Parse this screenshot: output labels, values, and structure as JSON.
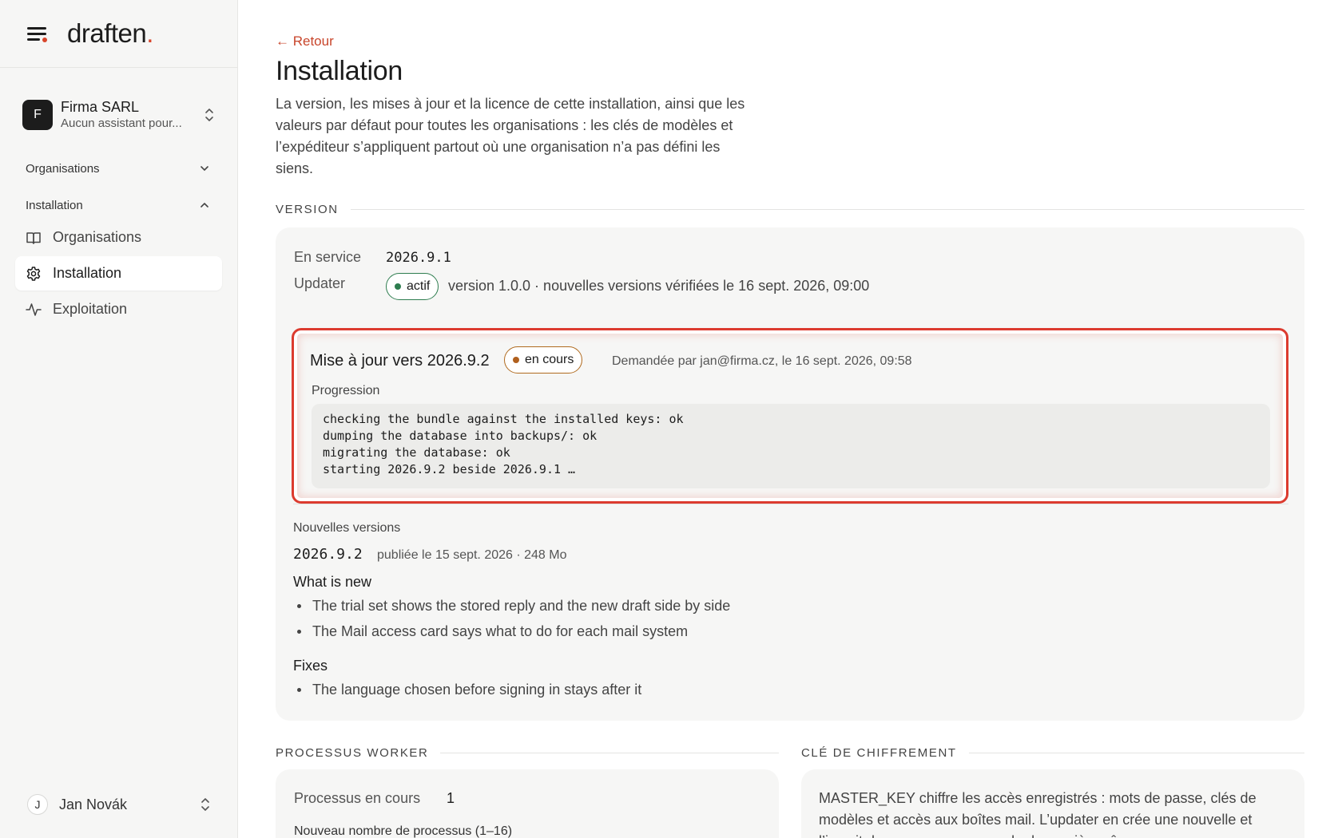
{
  "app": {
    "brand": "draften",
    "brand_dot": "."
  },
  "org": {
    "initial": "F",
    "name": "Firma SARL",
    "subtitle": "Aucun assistant pour..."
  },
  "nav": {
    "group_organisations": "Organisations",
    "group_installation": "Installation",
    "items": [
      {
        "label": "Organisations",
        "icon": "book-icon"
      },
      {
        "label": "Installation",
        "icon": "gear-icon",
        "active": true
      },
      {
        "label": "Exploitation",
        "icon": "activity-icon"
      }
    ]
  },
  "user": {
    "initial": "J",
    "name": "Jan Novák"
  },
  "page": {
    "back": "← Retour",
    "title": "Installation",
    "intro": "La version, les mises à jour et la licence de cette installation, ainsi que les valeurs par défaut pour toutes les organisations : les clés de modèles et l’expéditeur s’appliquent partout où une organisation n’a pas défini les siens."
  },
  "version": {
    "section": "VERSION",
    "in_service_label": "En service",
    "in_service_value": "2026.9.1",
    "updater_label": "Updater",
    "updater_badge": "actif",
    "updater_text": "version 1.0.0 · nouvelles versions vérifiées le 16 sept. 2026, 09:00",
    "update": {
      "title": "Mise à jour vers 2026.9.2",
      "badge": "en cours",
      "requested": "Demandée par jan@firma.cz, le 16 sept. 2026, 09:58",
      "progress_label": "Progression",
      "log": "checking the bundle against the installed keys: ok\ndumping the database into backups/: ok\nmigrating the database: ok\nstarting 2026.9.2 beside 2026.9.1 …"
    },
    "new_versions_label": "Nouvelles versions",
    "release": {
      "version": "2026.9.2",
      "meta": "publiée le 15 sept. 2026 · 248 Mo",
      "whats_new_heading": "What is new",
      "whats_new": [
        "The trial set shows the stored reply and the new draft side by side",
        "The Mail access card says what to do for each mail system"
      ],
      "fixes_heading": "Fixes",
      "fixes": [
        "The language chosen before signing in stays after it"
      ]
    }
  },
  "worker": {
    "section": "PROCESSUS WORKER",
    "running_label": "Processus en cours",
    "running_value": "1",
    "new_count_label": "Nouveau nombre de processus (1–16)"
  },
  "encryption": {
    "section": "CLÉ DE CHIFFREMENT",
    "text": "MASTER_KEY chiffre les accès enregistrés : mots de passe, clés de modèles et accès aux boîtes mail. L’updater en crée une nouvelle et l’inscrit dans .env ; conservez-la de manière sûre."
  },
  "colors": {
    "accent": "#d9452b",
    "highlight": "#dc3b2f",
    "active_green": "#2e7d4f",
    "progress_orange": "#b0601e"
  }
}
